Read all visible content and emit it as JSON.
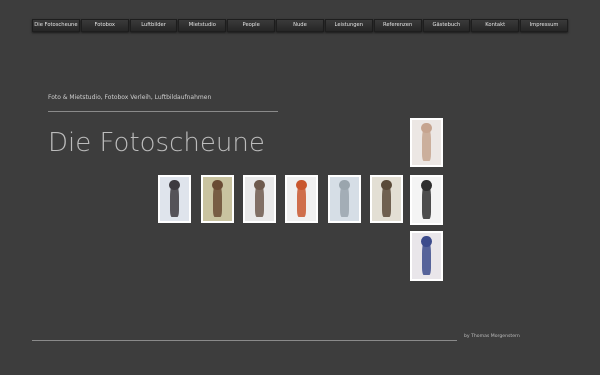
{
  "nav": {
    "items": [
      {
        "label": "Die Fotoscheune"
      },
      {
        "label": "Fotobox"
      },
      {
        "label": "Luftbilder"
      },
      {
        "label": "Mietstudio"
      },
      {
        "label": "People"
      },
      {
        "label": "Nude"
      },
      {
        "label": "Leistungen"
      },
      {
        "label": "Referenzen"
      },
      {
        "label": "Gästebuch"
      },
      {
        "label": "Kontakt"
      },
      {
        "label": "Impressum"
      }
    ]
  },
  "header": {
    "tagline": "Foto & Mietstudio, Fotobox Verleih, Luftbildaufnahmen",
    "title": "Die Fotoscheune"
  },
  "gallery": {
    "photos": [
      {
        "name": "photo-top-right",
        "bg": "#ece7e4",
        "figure": "#c6a48f"
      },
      {
        "name": "photo-row-1",
        "bg": "#dfe4ec",
        "figure": "#3d3a40"
      },
      {
        "name": "photo-row-2",
        "bg": "#c9c3a0",
        "figure": "#6a4b34"
      },
      {
        "name": "photo-row-3",
        "bg": "#e9e9e9",
        "figure": "#6e5a4d"
      },
      {
        "name": "photo-row-4",
        "bg": "#f0f0f0",
        "figure": "#c9572e"
      },
      {
        "name": "photo-row-5",
        "bg": "#d6dee6",
        "figure": "#9aa5ad"
      },
      {
        "name": "photo-row-6",
        "bg": "#e3dfd4",
        "figure": "#5a4a38"
      },
      {
        "name": "photo-row-7",
        "bg": "#f4f4f4",
        "figure": "#2e2e2e"
      },
      {
        "name": "photo-bottom-right",
        "bg": "#e9e6ea",
        "figure": "#3c4b8c"
      }
    ]
  },
  "footer": {
    "credit": "by Thomas Morgenstern"
  }
}
